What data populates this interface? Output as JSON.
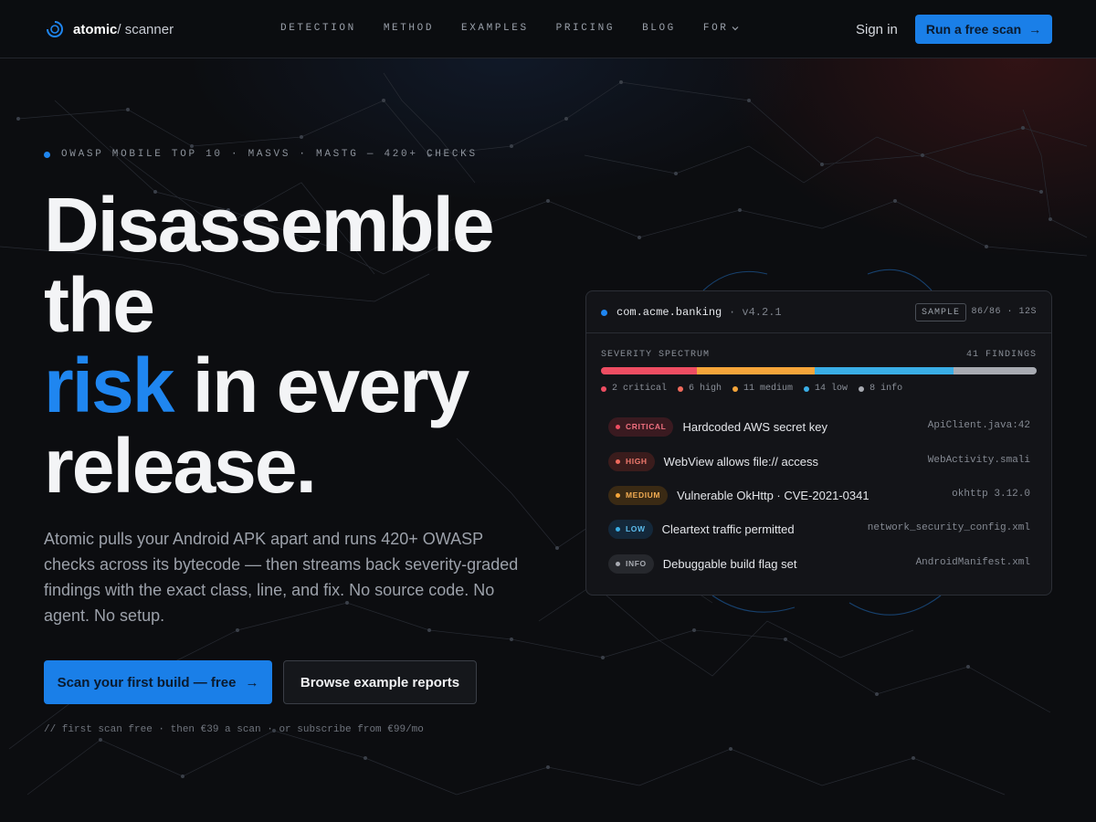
{
  "nav": {
    "brand_name": "atomic",
    "brand_sub": "/ scanner",
    "links": [
      "DETECTION",
      "METHOD",
      "EXAMPLES",
      "PRICING",
      "BLOG",
      "FOR"
    ],
    "signin": "Sign in",
    "cta": "Run a free scan",
    "cta_arrow": "→"
  },
  "hero": {
    "eyebrow": "OWASP MOBILE TOP 10 · MASVS · MASTG — 420+ CHECKS",
    "headline_line1": "Disassemble",
    "headline_line2": "the",
    "headline_accent": "risk",
    "headline_line3_rest": " in every",
    "headline_line4": "release.",
    "lead": "Atomic pulls your Android APK apart and runs 420+ OWASP checks across its bytecode — then streams back severity-graded findings with the exact class, line, and fix. No source code. No agent. No setup.",
    "primary_button": "Scan your first build — free",
    "primary_arrow": "→",
    "secondary_button": "Browse example reports",
    "pricing_note": "// first scan free · then €39 a scan · or subscribe from €99/mo"
  },
  "report": {
    "package": "com.acme.banking",
    "version": "· v4.2.1",
    "sample_badge": "SAMPLE",
    "scan_stats": "86/86 · 12S",
    "spectrum_label": "SEVERITY SPECTRUM",
    "findings_count": "41 FINDINGS",
    "colors": {
      "critical": "#ee4d62",
      "high": "#f06a5c",
      "medium": "#f5a53a",
      "low": "#3aaee6",
      "info": "#a8abb2"
    },
    "spectrum": [
      {
        "level": "critical",
        "count": 2,
        "share": 0.22,
        "color": "#ee4d62"
      },
      {
        "level": "medium",
        "count": 11,
        "share": 0.27,
        "color": "#f5a53a"
      },
      {
        "level": "low",
        "count": 14,
        "share": 0.32,
        "color": "#3aaee6"
      },
      {
        "level": "info",
        "count": 8,
        "share": 0.19,
        "color": "#a8abb2"
      }
    ],
    "legend": [
      {
        "label": "2 critical",
        "color": "#ee4d62"
      },
      {
        "label": "6 high",
        "color": "#f06a5c"
      },
      {
        "label": "11 medium",
        "color": "#f5a53a"
      },
      {
        "label": "14 low",
        "color": "#3aaee6"
      },
      {
        "label": "8 info",
        "color": "#a8abb2"
      }
    ],
    "findings": [
      {
        "severity": "CRITICAL",
        "title": "Hardcoded AWS secret key",
        "location": "ApiClient.java:42"
      },
      {
        "severity": "HIGH",
        "title": "WebView allows file:// access",
        "location": "WebActivity.smali"
      },
      {
        "severity": "MEDIUM",
        "title": "Vulnerable OkHttp · CVE-2021-0341",
        "location": "okhttp 3.12.0"
      },
      {
        "severity": "LOW",
        "title": "Cleartext traffic permitted",
        "location": "network_security_config.xml"
      },
      {
        "severity": "INFO",
        "title": "Debuggable build flag set",
        "location": "AndroidManifest.xml"
      }
    ]
  }
}
